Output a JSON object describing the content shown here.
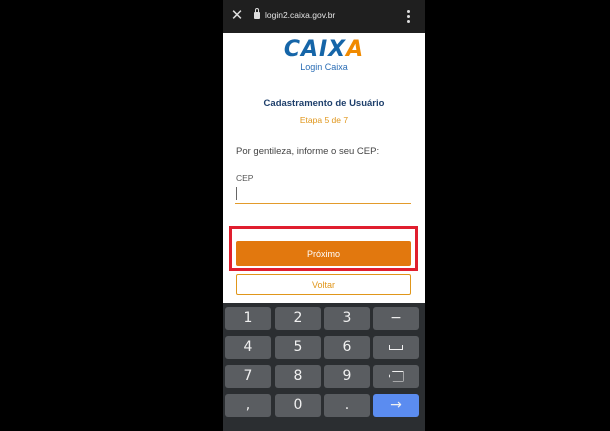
{
  "browser": {
    "url": "login2.caixa.gov.br",
    "close_icon": "close-icon",
    "menu_icon": "more-vert-icon"
  },
  "header": {
    "logo_main": "CAIX",
    "logo_accent": "A",
    "subtitle": "Login Caixa"
  },
  "form": {
    "title": "Cadastramento de Usuário",
    "step": "Etapa 5 de 7",
    "prompt": "Por gentileza, informe o seu CEP:",
    "cep_label": "CEP",
    "cep_value": "",
    "next_label": "Próximo",
    "back_label": "Voltar"
  },
  "keyboard": {
    "row1": [
      "1",
      "2",
      "3",
      "−"
    ],
    "row2": [
      "4",
      "5",
      "6",
      "␣"
    ],
    "row3": [
      "7",
      "8",
      "9",
      "⌫"
    ],
    "row4": [
      ",",
      "0",
      ".",
      "→"
    ]
  },
  "colors": {
    "caixa_blue": "#1565a8",
    "caixa_orange": "#e2780e",
    "highlight_red": "#e01e2e",
    "keyboard_action": "#5b8cf0"
  }
}
